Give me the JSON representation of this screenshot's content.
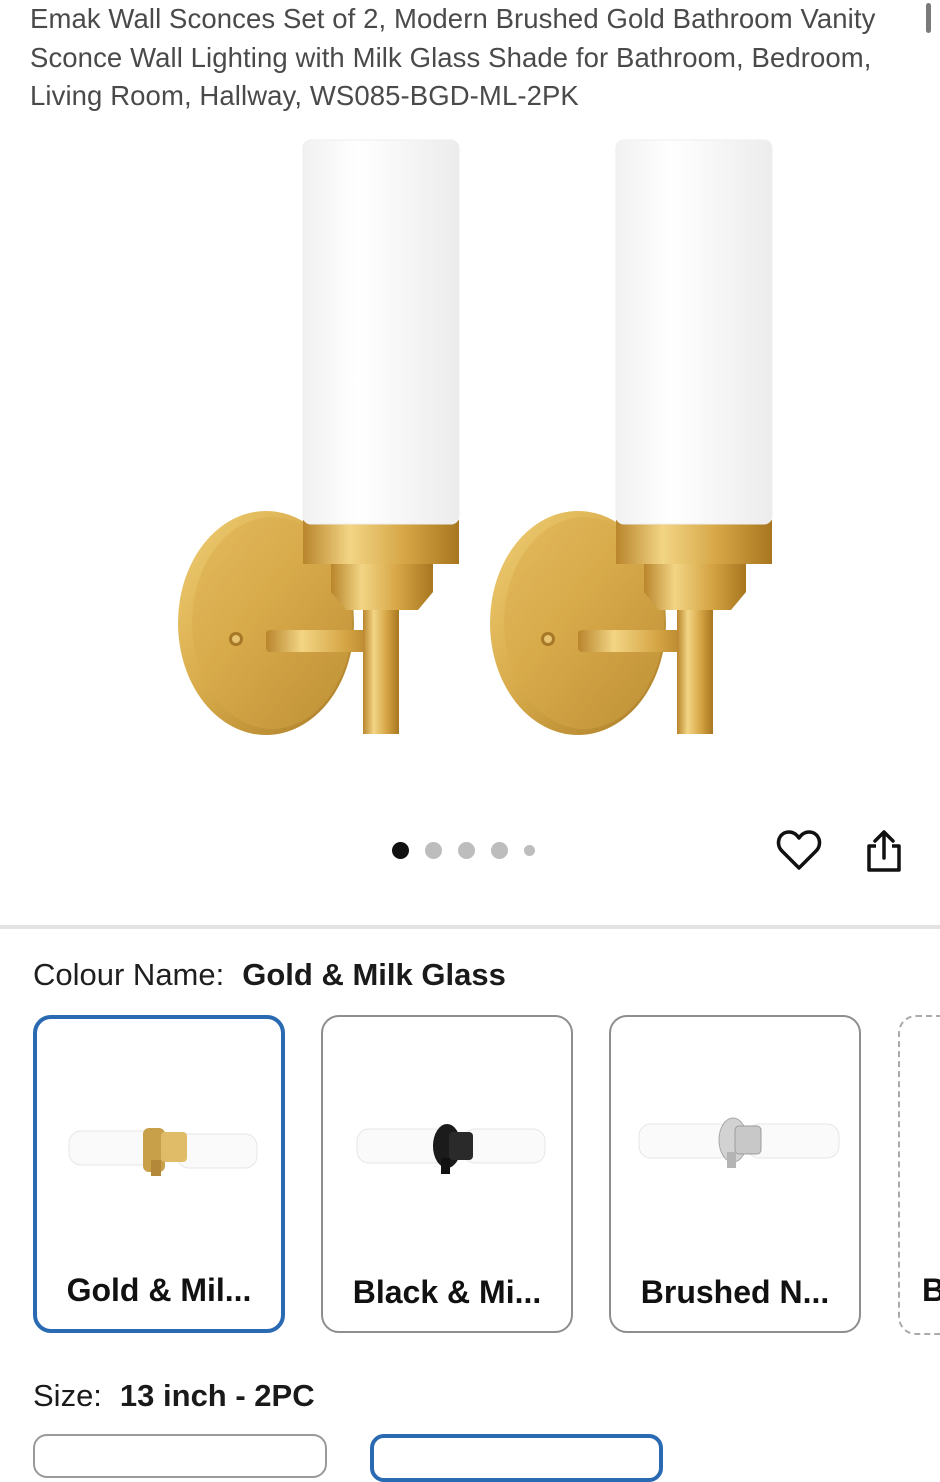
{
  "product": {
    "title": "Emak Wall Sconces Set of 2, Modern Brushed Gold Bathroom Vanity Sconce Wall Lighting with Milk Glass Shade for Bathroom, Bedroom, Living Room, Hallway, WS085-BGD-ML-2PK"
  },
  "gallery": {
    "image_count": 5,
    "active_index": 0,
    "favorite_icon": "heart-outline-icon",
    "share_icon": "share-icon"
  },
  "colour": {
    "label": "Colour Name:",
    "selected": "Gold & Milk Glass",
    "options": [
      {
        "label": "Gold & Mil...",
        "metal": "#c9a04a"
      },
      {
        "label": "Black & Mi...",
        "metal": "#1b1b1b"
      },
      {
        "label": "Brushed N...",
        "metal": "#c8c8c8"
      },
      {
        "label": "B",
        "metal": ""
      }
    ]
  },
  "size": {
    "label": "Size:",
    "selected": "13 inch - 2PC"
  },
  "colors": {
    "accent": "#2a6ab3",
    "gold": "#c9a04a",
    "glass": "#ffffff"
  }
}
